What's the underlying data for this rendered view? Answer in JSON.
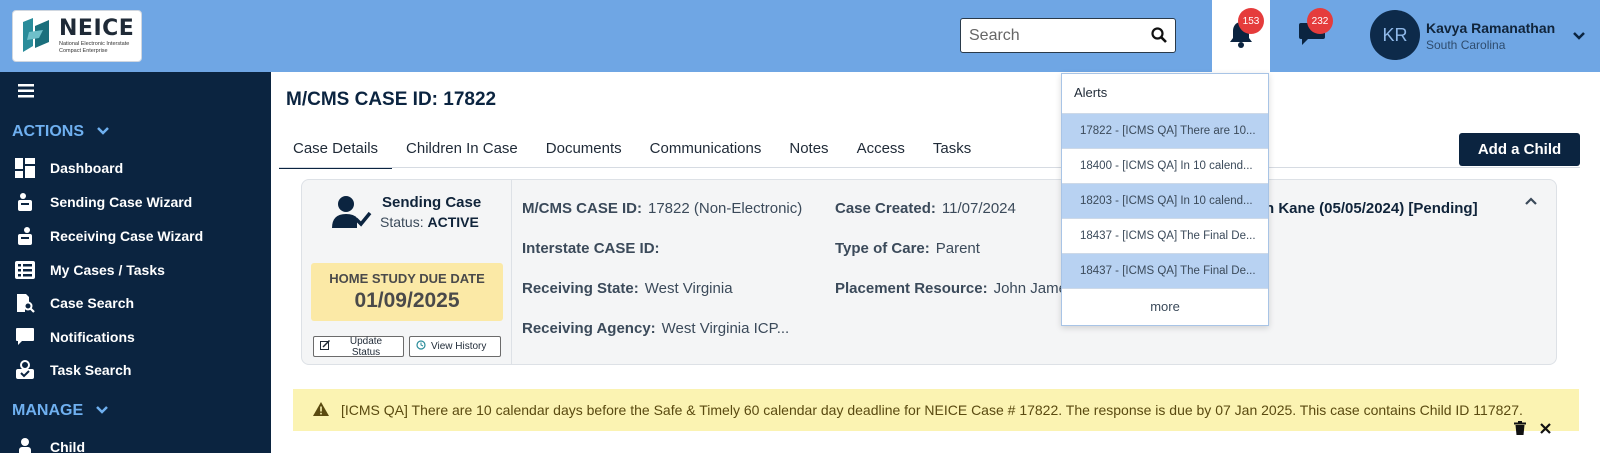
{
  "brand": {
    "name": "NEICE",
    "subtitle": "National Electronic Interstate Compact Enterprise"
  },
  "header": {
    "search_placeholder": "Search",
    "alerts_count": "153",
    "messages_count": "232",
    "user_initials": "KR",
    "user_name": "Kavya Ramanathan",
    "user_state": "South Carolina"
  },
  "sidebar": {
    "actions_title": "ACTIONS",
    "manage_title": "MANAGE",
    "items": [
      {
        "label": "Dashboard",
        "icon": "dashboard-icon"
      },
      {
        "label": "Sending Case Wizard",
        "icon": "sending-wizard-icon"
      },
      {
        "label": "Receiving Case Wizard",
        "icon": "receiving-wizard-icon"
      },
      {
        "label": "My Cases / Tasks",
        "icon": "list-icon"
      },
      {
        "label": "Case Search",
        "icon": "case-search-icon"
      },
      {
        "label": "Notifications",
        "icon": "chat-icon"
      },
      {
        "label": "Task Search",
        "icon": "task-search-icon"
      }
    ],
    "partial_item": "Child"
  },
  "main": {
    "page_title": "M/CMS CASE ID: 17822",
    "tabs": [
      "Case Details",
      "Children In Case",
      "Documents",
      "Communications",
      "Notes",
      "Access",
      "Tasks"
    ],
    "active_tab": "Case Details",
    "add_child_label": "Add a Child"
  },
  "case": {
    "type": "Sending Case",
    "status_label": "Status:",
    "status_value": "ACTIVE",
    "due_label": "HOME STUDY DUE DATE",
    "due_date": "01/09/2025",
    "update_status_label": "Update Status",
    "view_history_label": "View History",
    "fields": {
      "mcms_id_label": "M/CMS CASE ID:",
      "mcms_id_value": "17822 (Non-Electronic)",
      "interstate_label": "Interstate CASE ID:",
      "interstate_value": "",
      "receiving_state_label": "Receiving State:",
      "receiving_state_value": "West Virginia",
      "receiving_agency_label": "Receiving Agency:",
      "receiving_agency_value": "West Virginia ICP...",
      "created_label": "Case Created:",
      "created_value": "11/07/2024",
      "care_label": "Type of Care:",
      "care_value": "Parent",
      "placement_label": "Placement Resource:",
      "placement_value": "John Jame"
    },
    "child_label": "n Kane (05/05/2024)  [Pending]"
  },
  "alert_banner": {
    "text": "[ICMS QA] There are 10 calendar days before the Safe & Timely 60 calendar day deadline for NEICE Case # 17822. The response is due by 07 Jan 2025. This case contains Child ID 117827."
  },
  "alerts_dropdown": {
    "title": "Alerts",
    "items": [
      "17822 - [ICMS QA] There are 10...",
      "18400 - [ICMS QA] In 10 calend...",
      "18203 - [ICMS QA] In 10 calend...",
      "18437 - [ICMS QA] The Final De...",
      "18437 - [ICMS QA] The Final De..."
    ],
    "more_label": "more"
  },
  "colors": {
    "topbar": "#6fa6e4",
    "sidebar": "#0b2440",
    "accent_blue": "#6fb0f0",
    "badge_red": "#e53c3c",
    "due_yellow": "#fbe9a6",
    "alert_yellow": "#fbf3b2"
  }
}
